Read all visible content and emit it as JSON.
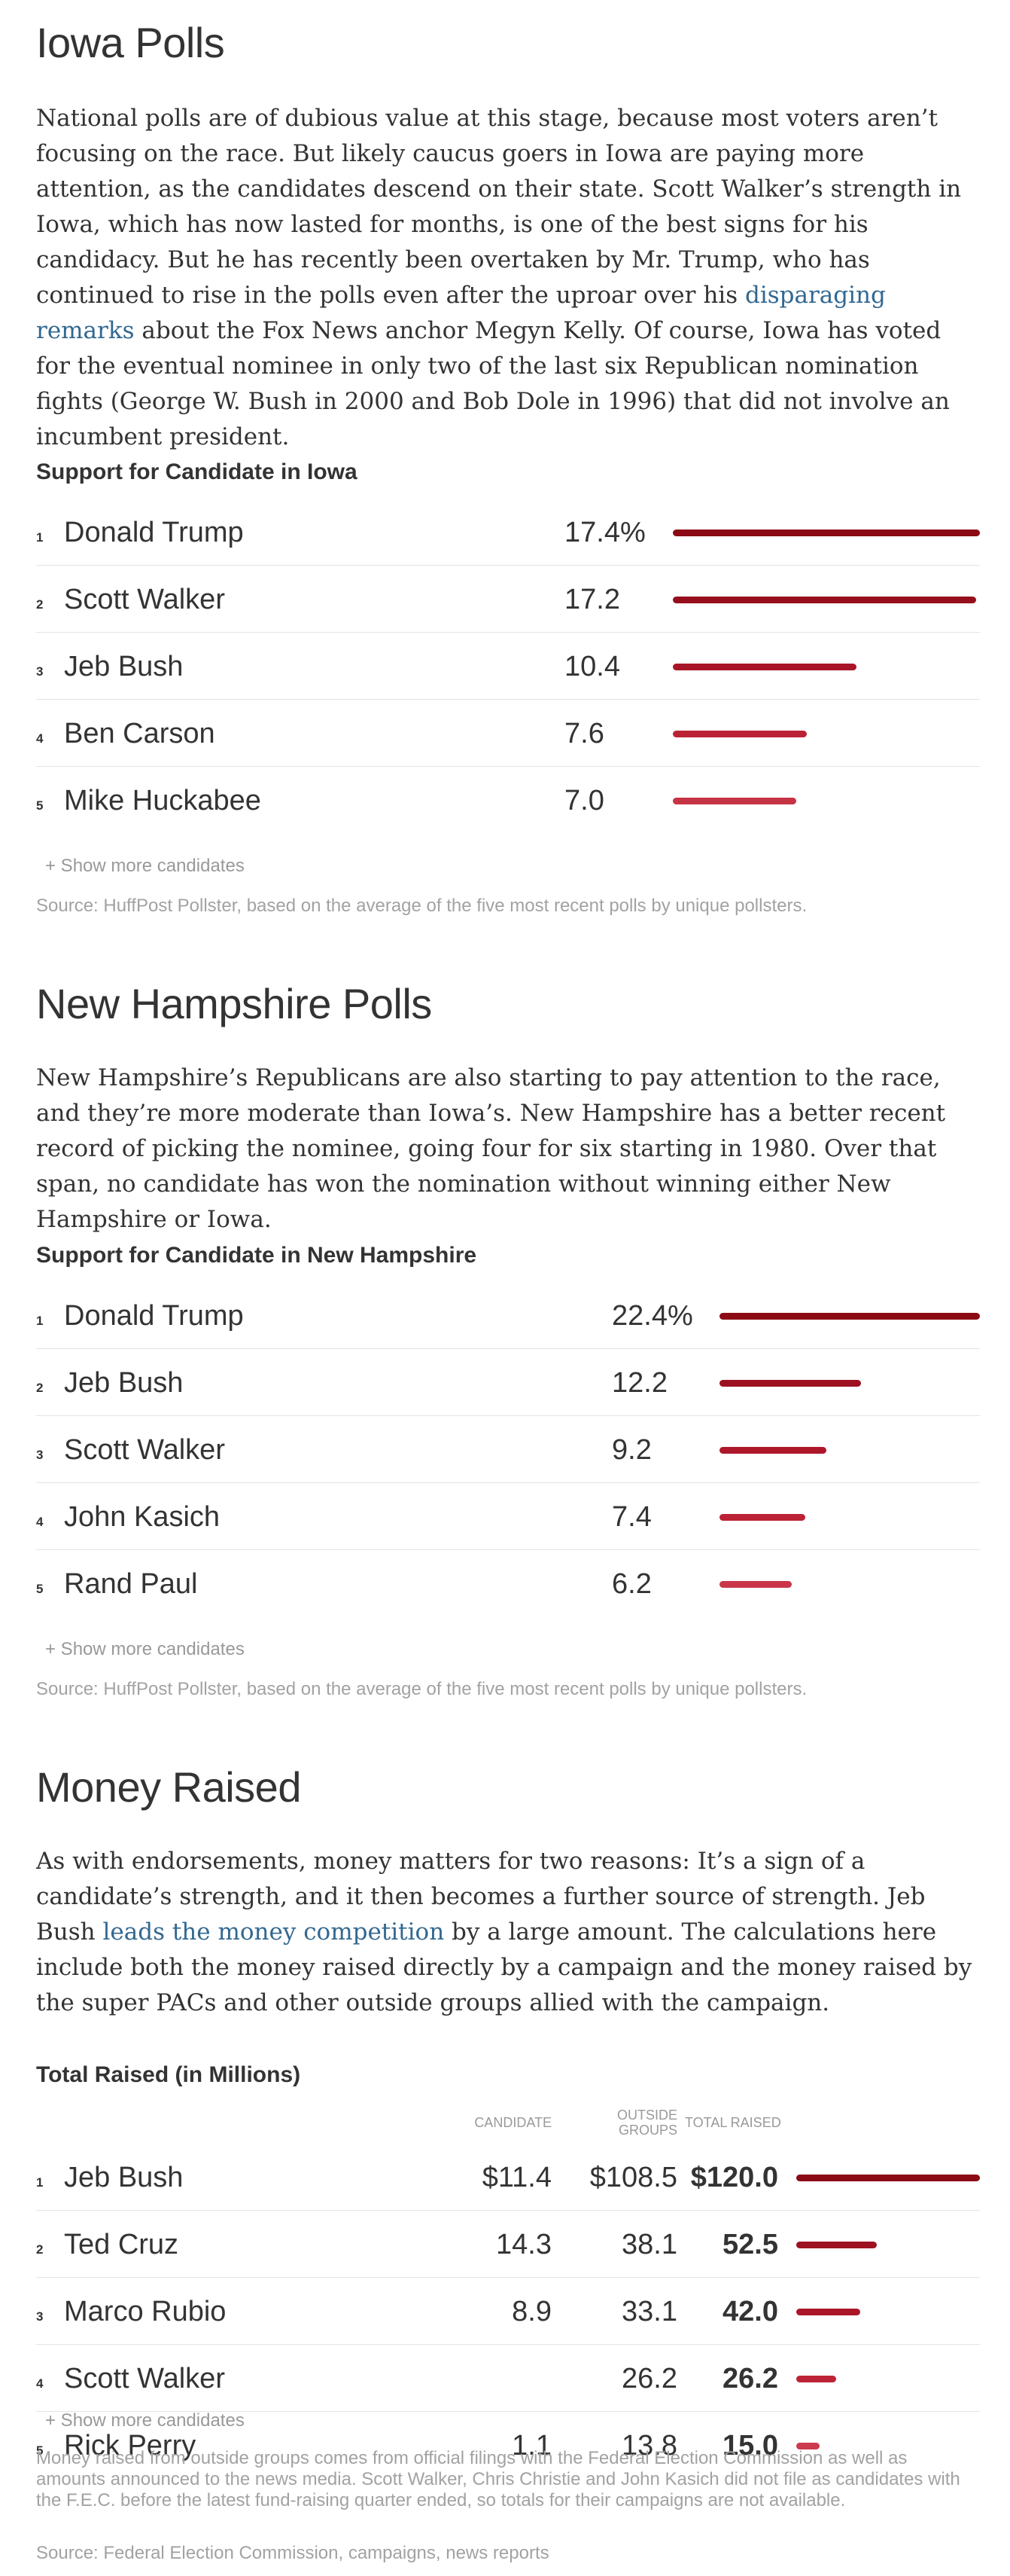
{
  "iowa": {
    "heading": "Iowa Polls",
    "paragraph": {
      "before_link": "National polls are of dubious value at this stage, because most voters aren’t focusing on the race. But likely caucus goers in Iowa are paying more attention, as the candidates descend on their state. Scott Walker’s strength in Iowa, which has now lasted for months, is one of the best signs for his candidacy. But he has recently been overtaken by Mr. Trump, who has continued to rise in the polls even after the uproar over his ",
      "link": "disparaging remarks",
      "after_link": " about the Fox News anchor Megyn Kelly. Of course, Iowa has voted for the eventual nominee in only two of the last six Republican nomination fights (George W. Bush in 2000 and Bob Dole in 1996) that did not involve an incumbent president."
    },
    "chart_title": "Support for Candidate in Iowa",
    "rows": [
      {
        "rank": "1",
        "name": "Donald Trump",
        "value_label": "17.4%",
        "value": 17.4,
        "color": "#8b0a14"
      },
      {
        "rank": "2",
        "name": "Scott Walker",
        "value_label": "17.2",
        "value": 17.2,
        "color": "#960f1c"
      },
      {
        "rank": "3",
        "name": "Jeb Bush",
        "value_label": "10.4",
        "value": 10.4,
        "color": "#a91528"
      },
      {
        "rank": "4",
        "name": "Ben Carson",
        "value_label": "7.6",
        "value": 7.6,
        "color": "#bc2236"
      },
      {
        "rank": "5",
        "name": "Mike Huckabee",
        "value_label": "7.0",
        "value": 7.0,
        "color": "#c63345"
      }
    ],
    "show_more": "+ Show more candidates",
    "source": "Source: HuffPost Pollster, based on the average of the five most recent polls by unique pollsters."
  },
  "nh": {
    "heading": "New Hampshire Polls",
    "paragraph": "New Hampshire’s Republicans are also starting to pay attention to the race, and they’re more moderate than Iowa’s. New Hampshire has a better recent record of picking the nominee, going four for six starting in 1980. Over that span, no candidate has won the nomination without winning either New Hampshire or Iowa.",
    "chart_title": "Support for Candidate in New Hampshire",
    "rows": [
      {
        "rank": "1",
        "name": "Donald Trump",
        "value_label": "22.4%",
        "value": 22.4,
        "color": "#8b0a14"
      },
      {
        "rank": "2",
        "name": "Jeb Bush",
        "value_label": "12.2",
        "value": 12.2,
        "color": "#9c1020"
      },
      {
        "rank": "3",
        "name": "Scott Walker",
        "value_label": "9.2",
        "value": 9.2,
        "color": "#ad1729"
      },
      {
        "rank": "4",
        "name": "John Kasich",
        "value_label": "7.4",
        "value": 7.4,
        "color": "#bc2236"
      },
      {
        "rank": "5",
        "name": "Rand Paul",
        "value_label": "6.2",
        "value": 6.2,
        "color": "#c9364a"
      }
    ],
    "show_more": "+ Show more candidates",
    "source": "Source: HuffPost Pollster, based on the average of the five most recent polls by unique pollsters."
  },
  "money": {
    "heading": "Money Raised",
    "paragraph": {
      "before_link": "As with endorsements, money matters for two reasons: It’s a sign of a candidate’s strength, and it then becomes a further source of strength. Jeb Bush ",
      "link": "leads the money competition",
      "after_link": " by a large amount. The calculations here include both the money raised directly by a campaign and the money raised by the super PACs and other outside groups allied with the campaign."
    },
    "chart_title": "Total Raised (in Millions)",
    "col_candidate": "CANDIDATE",
    "col_outside": "OUTSIDE GROUPS",
    "col_total": "TOTAL RAISED",
    "rows": [
      {
        "rank": "1",
        "name": "Jeb Bush",
        "candidate": "$11.4",
        "outside": "$108.5",
        "total_label": "$120.0",
        "total": 120.0,
        "color": "#8b0a14"
      },
      {
        "rank": "2",
        "name": "Ted Cruz",
        "candidate": "14.3",
        "outside": "38.1",
        "total_label": "52.5",
        "total": 52.5,
        "color": "#9e1121"
      },
      {
        "rank": "3",
        "name": "Marco Rubio",
        "candidate": "8.9",
        "outside": "33.1",
        "total_label": "42.0",
        "total": 42.0,
        "color": "#ab1628"
      },
      {
        "rank": "4",
        "name": "Scott Walker",
        "candidate": "",
        "outside": "26.2",
        "total_label": "26.2",
        "total": 26.2,
        "color": "#bd2337"
      },
      {
        "rank": "5",
        "name": "Rick Perry",
        "candidate": "1.1",
        "outside": "13.8",
        "total_label": "15.0",
        "total": 15.0,
        "color": "#cb3a4d"
      }
    ],
    "show_more": "+ Show more candidates",
    "note": "Money raised from outside groups comes from official filings with the Federal Election Commission as well as amounts announced to the news media. Scott Walker, Chris Christie and John Kasich did not file as candidates with the F.E.C. before the latest fund-raising quarter ended, so totals for their campaigns are not available.",
    "source": "Source: Federal Election Commission, campaigns, news reports"
  },
  "chart_data": [
    {
      "type": "bar",
      "title": "Support for Candidate in Iowa",
      "categories": [
        "Donald Trump",
        "Scott Walker",
        "Jeb Bush",
        "Ben Carson",
        "Mike Huckabee"
      ],
      "values": [
        17.4,
        17.2,
        10.4,
        7.6,
        7.0
      ]
    },
    {
      "type": "bar",
      "title": "Support for Candidate in New Hampshire",
      "categories": [
        "Donald Trump",
        "Jeb Bush",
        "Scott Walker",
        "John Kasich",
        "Rand Paul"
      ],
      "values": [
        22.4,
        12.2,
        9.2,
        7.4,
        6.2
      ]
    },
    {
      "type": "table",
      "title": "Total Raised (in Millions)",
      "categories": [
        "Jeb Bush",
        "Ted Cruz",
        "Marco Rubio",
        "Scott Walker",
        "Rick Perry"
      ],
      "series": [
        {
          "name": "Candidate",
          "values": [
            11.4,
            14.3,
            8.9,
            null,
            1.1
          ]
        },
        {
          "name": "Outside groups",
          "values": [
            108.5,
            38.1,
            33.1,
            26.2,
            13.8
          ]
        },
        {
          "name": "Total raised",
          "values": [
            120.0,
            52.5,
            42.0,
            26.2,
            15.0
          ]
        }
      ]
    }
  ]
}
